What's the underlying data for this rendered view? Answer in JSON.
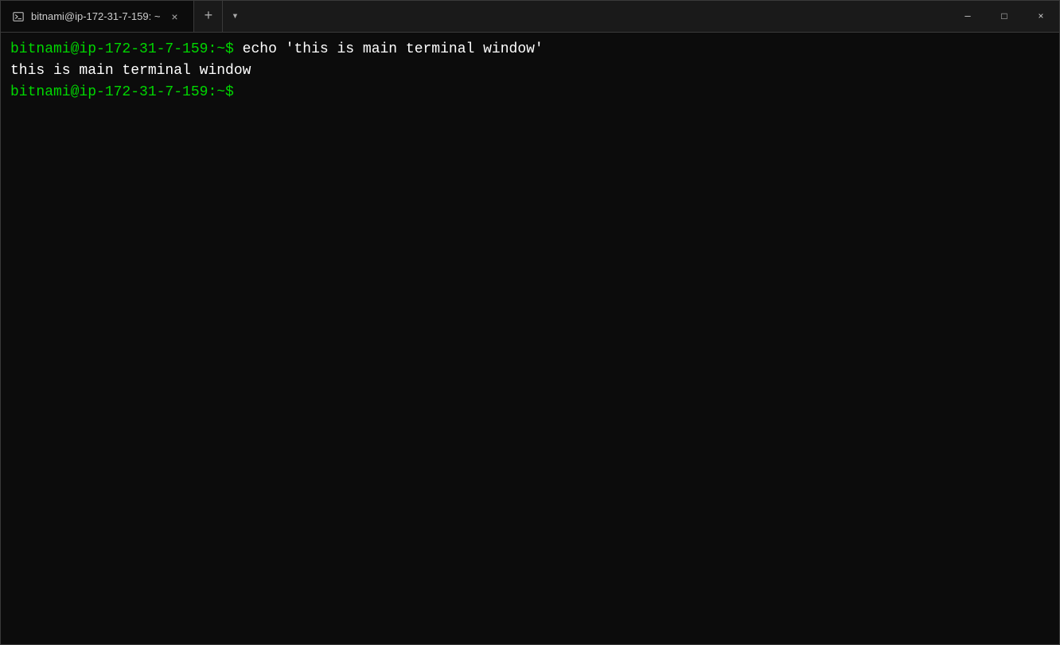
{
  "window": {
    "title": "bitnami@ip-172-31-7-159: ~"
  },
  "titlebar": {
    "tab_title": "bitnami@ip-172-31-7-159: ~",
    "close_label": "×",
    "new_tab_label": "+",
    "dropdown_label": "▾",
    "minimize_label": "─",
    "maximize_label": "□",
    "window_close_label": "×"
  },
  "terminal": {
    "line1_prompt": "bitnami@ip-172-31-7-159:~$",
    "line1_command": " echo 'this is main terminal window'",
    "line2_output": "this is main terminal window",
    "line3_prompt": "bitnami@ip-172-31-7-159:~$"
  }
}
